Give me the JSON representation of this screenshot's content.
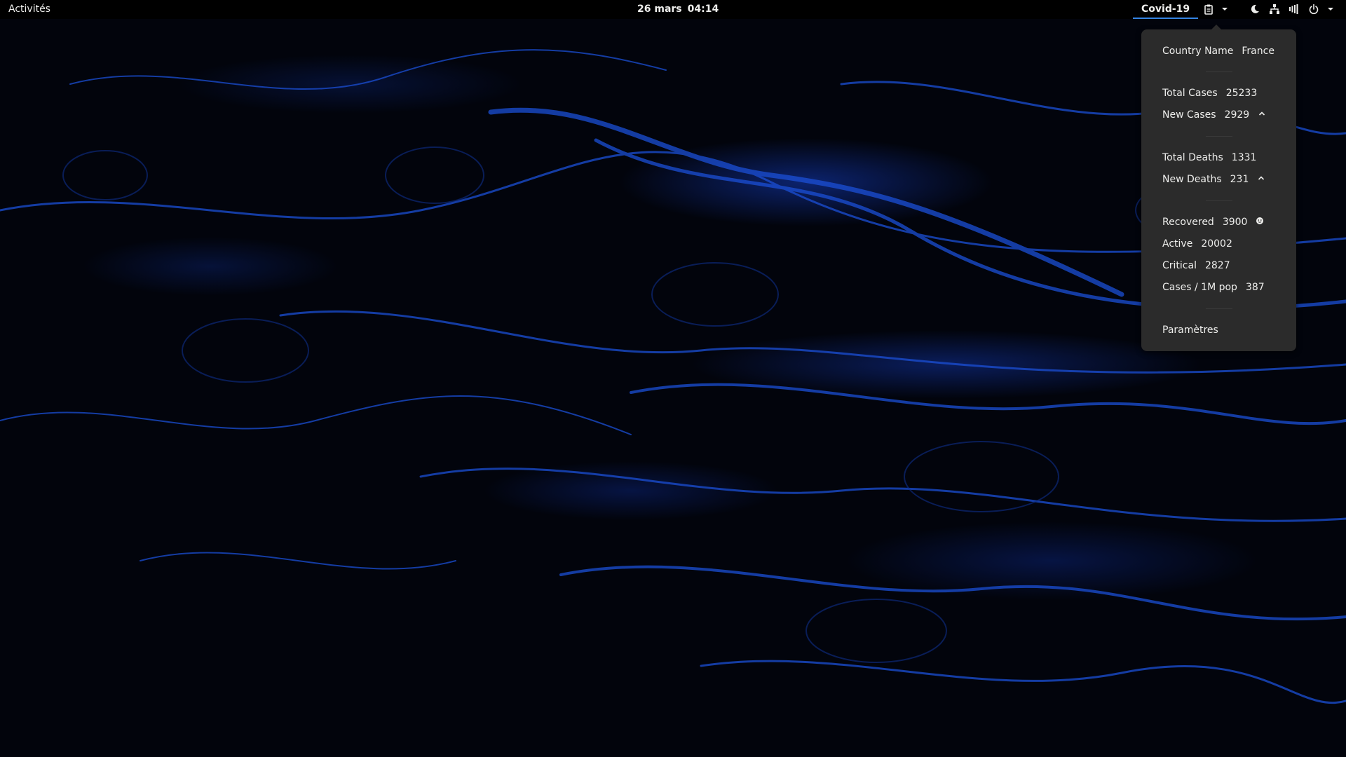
{
  "topbar": {
    "activities": "Activités",
    "date": "26 mars",
    "time": "04:14",
    "indicator": "Covid-19",
    "accent": "#3584e4",
    "tray_icons": [
      "clipboard-icon",
      "chevron-down-icon",
      "night-light-icon",
      "network-icon",
      "volume-icon",
      "power-icon",
      "chevron-down-icon"
    ]
  },
  "menu": {
    "country": {
      "label": "Country Name",
      "value": "France"
    },
    "total_cases": {
      "label": "Total Cases",
      "value": "25233"
    },
    "new_cases": {
      "label": "New Cases",
      "value": "2929",
      "icon": "chevron-up-icon"
    },
    "total_deaths": {
      "label": "Total Deaths",
      "value": "1331"
    },
    "new_deaths": {
      "label": "New Deaths",
      "value": "231",
      "icon": "chevron-up-icon"
    },
    "recovered": {
      "label": "Recovered",
      "value": "3900",
      "icon": "smiley-icon"
    },
    "active": {
      "label": "Active",
      "value": "20002"
    },
    "critical": {
      "label": "Critical",
      "value": "2827"
    },
    "per_million": {
      "label": "Cases / 1M pop",
      "value": "387"
    },
    "settings": "Paramètres"
  }
}
